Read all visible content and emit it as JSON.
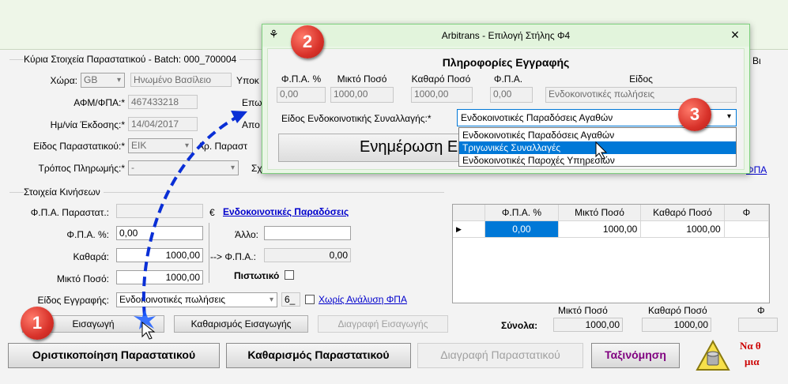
{
  "main": {
    "header_section_title": "Κύρια Στοιχεία Παραστατικού - Batch: 000_700004",
    "country_label": "Χώρα:",
    "country_code": "GB",
    "country_name": "Ηνωμένο Βασίλειο",
    "ypok_label": "Υποκ",
    "vat_label": "ΑΦΜ/ΦΠΑ:*",
    "vat_value": "467433218",
    "epon_label": "Επω",
    "date_label": "Ημ/νία Έκδοσης:*",
    "date_value": "14/04/2017",
    "apo_label": "Απο",
    "doc_type_label": "Είδος Παραστατικού:*",
    "doc_type_value": "ΕΙΚ",
    "ar_label": "Αρ. Παραστ",
    "payment_label": "Τρόπος Πληρωμής:*",
    "payment_value": "-",
    "sx_label": "Σχ",
    "right_label_vi": "Βι",
    "right_link_fpa": "ΦΠΑ"
  },
  "movements": {
    "section_title": "Στοιχεία Κινήσεων",
    "doc_vat_label": "Φ.Π.Α. Παραστατ.:",
    "currency_symbol": "€",
    "intra_deliveries_link": "Ενδοκοινοτικές Παραδόσεις",
    "vat_pct_label": "Φ.Π.Α. %:",
    "vat_pct_value": "0,00",
    "other_label": "Άλλο:",
    "net_label": "Καθαρά:",
    "net_value": "1000,00",
    "to_vat_label": "--> Φ.Π.Α.:",
    "to_vat_value": "0,00",
    "gross_label": "Μικτό Ποσό:",
    "gross_value": "1000,00",
    "credit_label": "Πιστωτικό",
    "entry_type_label": "Είδος Εγγραφής:",
    "entry_type_value": "Ενδοκοινοτικές πωλήσεις",
    "entry_code": "6_",
    "no_vat_analysis_label": "Χωρίς Ανάλυση ΦΠΑ",
    "insert_button": "Εισαγωγή",
    "clear_insert_button": "Καθαρισμός Εισαγωγής",
    "delete_insert_button": "Διαγραφή Εισαγωγής"
  },
  "grid": {
    "columns": [
      "Φ.Π.Α. %",
      "Μικτό Ποσό",
      "Καθαρό Ποσό",
      "Φ"
    ],
    "rows": [
      [
        "0,00",
        "1000,00",
        "1000,00",
        ""
      ]
    ]
  },
  "totals": {
    "label": "Σύνολα:",
    "gross_header": "Μικτό Ποσό",
    "net_header": "Καθαρό Ποσό",
    "right_header": "Φ",
    "gross_value": "1000,00",
    "net_value": "1000,00"
  },
  "bottom": {
    "finalize_button": "Οριστικοποίηση Παραστατικού",
    "clear_doc_button": "Καθαρισμός Παραστατικού",
    "delete_doc_button": "Διαγραφή Παραστατικού",
    "sort_button": "Ταξινόμηση",
    "warning_text_1": "Να θ",
    "warning_text_2": "μια"
  },
  "dialog": {
    "title": "Arbitrans - Επιλογή Στήλης Φ4",
    "close_glyph": "×",
    "section_title": "Πληροφορίες Εγγραφής",
    "col_vat_pct": "Φ.Π.Α. %",
    "col_gross": "Μικτό Ποσό",
    "col_net": "Καθαρό Ποσό",
    "col_vat": "Φ.Π.Α.",
    "col_type": "Είδος",
    "val_vat_pct": "0,00",
    "val_gross": "1000,00",
    "val_net": "1000,00",
    "val_vat": "0,00",
    "val_type": "Ενδοκοινοτικές πωλήσεις",
    "transaction_label": "Είδος Ενδοκοινοτικής Συναλλαγής:*",
    "transaction_selected": "Ενδοκοινοτικές Παραδόσεις Αγαθών",
    "options": [
      "Ενδοκοινοτικές Παραδόσεις Αγαθών",
      "Τριγωνικές Συναλλαγές",
      "Ενδοκοινοτικές Παροχές Υπηρεσιών"
    ],
    "update_button": "Ενημέρωση Ε"
  },
  "badges": {
    "one": "1",
    "two": "2",
    "three": "3"
  },
  "colors": {
    "accent_blue": "#0000cc",
    "highlight": "#0078d7",
    "dialog_border": "#7fd07f",
    "badge_red": "#d8322a"
  }
}
